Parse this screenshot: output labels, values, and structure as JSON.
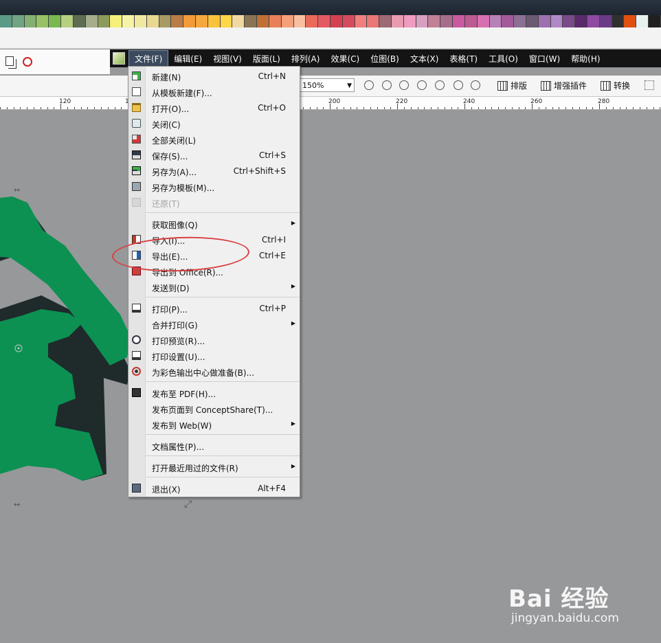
{
  "palette_colors": [
    "#5a9a86",
    "#6fa582",
    "#84b072",
    "#98c066",
    "#7ab850",
    "#b5d080",
    "#5f6e52",
    "#a5ad8d",
    "#8c9a5c",
    "#f5f07a",
    "#f7f3a6",
    "#f0e8a0",
    "#e8d890",
    "#a89a64",
    "#b87c44",
    "#f39a3a",
    "#f6a840",
    "#f9c23a",
    "#ffd54a",
    "#f2d8a0",
    "#8a7454",
    "#c07036",
    "#e8805a",
    "#f4a07a",
    "#f8c0a0",
    "#e96a5a",
    "#e45a64",
    "#d54050",
    "#d64a5e",
    "#f08080",
    "#e97878",
    "#9e6a74",
    "#e89aae",
    "#ef9cc0",
    "#d8a0c0",
    "#c08098",
    "#a86d8a",
    "#c95aa0",
    "#be5a92",
    "#d670b0",
    "#b880b8",
    "#a45a9a",
    "#8c7094",
    "#6a5a72",
    "#9e70b0",
    "#b088c8",
    "#7a4a8a",
    "#5a2a6a",
    "#8e4aa0",
    "#6a3a86",
    "#303030",
    "#e05010",
    "#e8f0f0",
    "#202020"
  ],
  "left_icons": [
    "copy-icon",
    "no-print-icon"
  ],
  "menubar": {
    "items": [
      "文件(F)",
      "编辑(E)",
      "视图(V)",
      "版面(L)",
      "排列(A)",
      "效果(C)",
      "位图(B)",
      "文本(X)",
      "表格(T)",
      "工具(O)",
      "窗口(W)",
      "帮助(H)"
    ],
    "active_index": 0
  },
  "toolbar": {
    "zoom_value": "150%",
    "buttons": [
      "排版",
      "增强插件",
      "转换"
    ]
  },
  "ruler": {
    "labels": [
      "120",
      "1",
      "200",
      "220",
      "240",
      "260",
      "280"
    ]
  },
  "file_menu": {
    "items": [
      {
        "label": "新建(N)",
        "shortcut": "Ctrl+N",
        "icon": "new-document-icon",
        "enabled": true,
        "submenu": false
      },
      {
        "label": "从模板新建(F)...",
        "shortcut": "",
        "icon": "new-from-template-icon",
        "enabled": true,
        "submenu": false
      },
      {
        "label": "打开(O)...",
        "shortcut": "Ctrl+O",
        "icon": "open-folder-icon",
        "enabled": true,
        "submenu": false
      },
      {
        "label": "关闭(C)",
        "shortcut": "",
        "icon": "close-document-icon",
        "enabled": true,
        "submenu": false
      },
      {
        "label": "全部关闭(L)",
        "shortcut": "",
        "icon": "close-all-icon",
        "enabled": true,
        "submenu": false
      },
      {
        "label": "保存(S)...",
        "shortcut": "Ctrl+S",
        "icon": "save-icon",
        "enabled": true,
        "submenu": false
      },
      {
        "label": "另存为(A)...",
        "shortcut": "Ctrl+Shift+S",
        "icon": "save-as-icon",
        "enabled": true,
        "submenu": false
      },
      {
        "label": "另存为模板(M)...",
        "shortcut": "",
        "icon": "save-as-template-icon",
        "enabled": true,
        "submenu": false
      },
      {
        "label": "还原(T)",
        "shortcut": "",
        "icon": "revert-icon",
        "enabled": false,
        "submenu": false
      },
      {
        "label": "获取图像(Q)",
        "shortcut": "",
        "icon": "",
        "enabled": true,
        "submenu": true
      },
      {
        "label": "导入(I)...",
        "shortcut": "Ctrl+I",
        "icon": "import-icon",
        "enabled": true,
        "submenu": false
      },
      {
        "label": "导出(E)...",
        "shortcut": "Ctrl+E",
        "icon": "export-icon",
        "enabled": true,
        "submenu": false
      },
      {
        "label": "导出到 Office(R)...",
        "shortcut": "",
        "icon": "export-office-icon",
        "enabled": true,
        "submenu": false
      },
      {
        "label": "发送到(D)",
        "shortcut": "",
        "icon": "",
        "enabled": true,
        "submenu": true
      },
      {
        "label": "打印(P)...",
        "shortcut": "Ctrl+P",
        "icon": "printer-icon",
        "enabled": true,
        "submenu": false
      },
      {
        "label": "合并打印(G)",
        "shortcut": "",
        "icon": "",
        "enabled": true,
        "submenu": true
      },
      {
        "label": "打印预览(R)...",
        "shortcut": "",
        "icon": "print-preview-icon",
        "enabled": true,
        "submenu": false
      },
      {
        "label": "打印设置(U)...",
        "shortcut": "",
        "icon": "print-setup-icon",
        "enabled": true,
        "submenu": false
      },
      {
        "label": "为彩色输出中心做准备(B)...",
        "shortcut": "",
        "icon": "color-output-icon",
        "enabled": true,
        "submenu": false
      },
      {
        "label": "发布至 PDF(H)...",
        "shortcut": "",
        "icon": "pdf-icon",
        "enabled": true,
        "submenu": false
      },
      {
        "label": "发布页面到 ConceptShare(T)...",
        "shortcut": "",
        "icon": "",
        "enabled": true,
        "submenu": false
      },
      {
        "label": "发布到 Web(W)",
        "shortcut": "",
        "icon": "",
        "enabled": true,
        "submenu": true
      },
      {
        "label": "文档属性(P)...",
        "shortcut": "",
        "icon": "",
        "enabled": true,
        "submenu": false
      },
      {
        "label": "打开最近用过的文件(R)",
        "shortcut": "",
        "icon": "",
        "enabled": true,
        "submenu": true
      },
      {
        "label": "退出(X)",
        "shortcut": "Alt+F4",
        "icon": "exit-icon",
        "enabled": true,
        "submenu": false
      }
    ]
  },
  "watermark": {
    "logo_text": "Bai 经验",
    "url": "jingyan.baidu.com"
  }
}
